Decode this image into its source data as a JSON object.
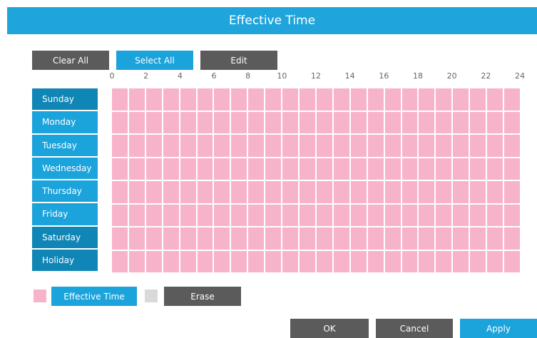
{
  "dialog": {
    "title": "Effective Time"
  },
  "toolbar": {
    "clear_all": "Clear All",
    "select_all": "Select All",
    "edit": "Edit"
  },
  "hours": [
    "0",
    "2",
    "4",
    "6",
    "8",
    "10",
    "12",
    "14",
    "16",
    "18",
    "20",
    "22",
    "24"
  ],
  "days": [
    "Sunday",
    "Monday",
    "Tuesday",
    "Wednesday",
    "Thursday",
    "Friday",
    "Saturday",
    "Holiday"
  ],
  "legend": {
    "effective_time": "Effective Time",
    "erase": "Erase"
  },
  "footer": {
    "ok": "OK",
    "cancel": "Cancel",
    "apply": "Apply"
  },
  "colors": {
    "title_bar": "#1fa5dc",
    "effective": "#f7b3c9",
    "erase": "#d9d9d9",
    "button_dark": "#5b5b5b",
    "button_blue": "#1ba3dc"
  }
}
